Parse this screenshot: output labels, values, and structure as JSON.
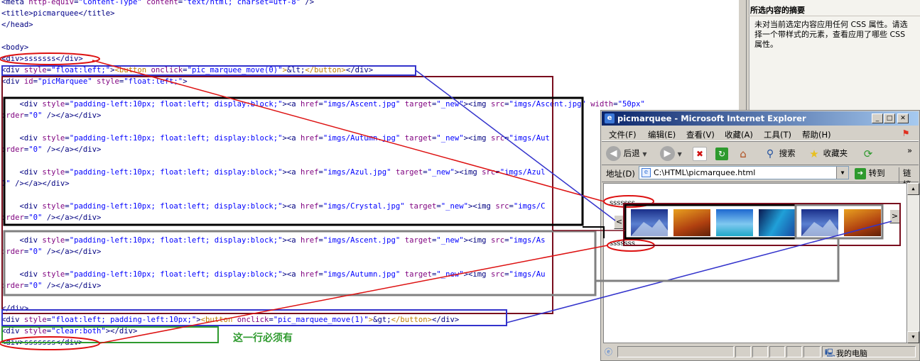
{
  "code_lines": [
    [
      [
        "t",
        "<meta "
      ],
      [
        "a",
        "http-equiv"
      ],
      [
        "t",
        "="
      ],
      [
        "v",
        "\"Content-Type\""
      ],
      [
        "t",
        " "
      ],
      [
        "a",
        "content"
      ],
      [
        "t",
        "="
      ],
      [
        "v",
        "\"text/html; charset=utf-8\""
      ],
      [
        "t",
        " />"
      ]
    ],
    [
      [
        "t",
        "<title>"
      ],
      [
        "s",
        "picmarquee"
      ],
      [
        "t",
        "</title>"
      ]
    ],
    [
      [
        "t",
        "</head>"
      ]
    ],
    [
      [
        "s",
        ""
      ]
    ],
    [
      [
        "t",
        "<body>"
      ]
    ],
    [
      [
        "t",
        "<div>"
      ],
      [
        "s",
        "sssssss"
      ],
      [
        "t",
        "</div>"
      ]
    ],
    [
      [
        "t",
        "<div "
      ],
      [
        "a",
        "style"
      ],
      [
        "t",
        "="
      ],
      [
        "v",
        "\"float:left;\""
      ],
      [
        "t",
        ">"
      ],
      [
        "o",
        "<button "
      ],
      [
        "a",
        "onclick"
      ],
      [
        "t",
        "="
      ],
      [
        "v",
        "\"pic_marquee_move(0)\""
      ],
      [
        "o",
        ">"
      ],
      [
        "s",
        "&lt;"
      ],
      [
        "o",
        "</button>"
      ],
      [
        "t",
        "</div>"
      ]
    ],
    [
      [
        "t",
        "<div "
      ],
      [
        "a",
        "id"
      ],
      [
        "t",
        "="
      ],
      [
        "v",
        "\"picMarquee\""
      ],
      [
        "t",
        " "
      ],
      [
        "a",
        "style"
      ],
      [
        "t",
        "="
      ],
      [
        "v",
        "\"float:left;\""
      ],
      [
        "t",
        ">"
      ]
    ],
    [
      [
        "s",
        ""
      ]
    ],
    [
      [
        "s",
        "    "
      ],
      [
        "t",
        "<div "
      ],
      [
        "a",
        "style"
      ],
      [
        "t",
        "="
      ],
      [
        "v",
        "\"padding-left:10px; float:left; display:block;\""
      ],
      [
        "t",
        "><a "
      ],
      [
        "a",
        "href"
      ],
      [
        "t",
        "="
      ],
      [
        "v",
        "\"imgs/Ascent.jpg\""
      ],
      [
        "t",
        " "
      ],
      [
        "a",
        "target"
      ],
      [
        "t",
        "="
      ],
      [
        "v",
        "\"_new\""
      ],
      [
        "t",
        "><img "
      ],
      [
        "a",
        "src"
      ],
      [
        "t",
        "="
      ],
      [
        "v",
        "\"imgs/Ascent.jpg\""
      ],
      [
        "t",
        " "
      ],
      [
        "a",
        "width"
      ],
      [
        "t",
        "="
      ],
      [
        "v",
        "\"50px\""
      ]
    ],
    [
      [
        "a",
        "order"
      ],
      [
        "t",
        "="
      ],
      [
        "v",
        "\"0\""
      ],
      [
        "t",
        " /></a></div>"
      ]
    ],
    [
      [
        "s",
        ""
      ]
    ],
    [
      [
        "s",
        "    "
      ],
      [
        "t",
        "<div "
      ],
      [
        "a",
        "style"
      ],
      [
        "t",
        "="
      ],
      [
        "v",
        "\"padding-left:10px; float:left; display:block;\""
      ],
      [
        "t",
        "><a "
      ],
      [
        "a",
        "href"
      ],
      [
        "t",
        "="
      ],
      [
        "v",
        "\"imgs/Autumn.jpg\""
      ],
      [
        "t",
        " "
      ],
      [
        "a",
        "target"
      ],
      [
        "t",
        "="
      ],
      [
        "v",
        "\"_new\""
      ],
      [
        "t",
        "><img "
      ],
      [
        "a",
        "src"
      ],
      [
        "t",
        "="
      ],
      [
        "v",
        "\"imgs/Aut"
      ]
    ],
    [
      [
        "a",
        "order"
      ],
      [
        "t",
        "="
      ],
      [
        "v",
        "\"0\""
      ],
      [
        "t",
        " /></a></div>"
      ]
    ],
    [
      [
        "s",
        ""
      ]
    ],
    [
      [
        "s",
        "    "
      ],
      [
        "t",
        "<div "
      ],
      [
        "a",
        "style"
      ],
      [
        "t",
        "="
      ],
      [
        "v",
        "\"padding-left:10px; float:left; display:block;\""
      ],
      [
        "t",
        "><a "
      ],
      [
        "a",
        "href"
      ],
      [
        "t",
        "="
      ],
      [
        "v",
        "\"imgs/Azul.jpg\""
      ],
      [
        "t",
        " "
      ],
      [
        "a",
        "target"
      ],
      [
        "t",
        "="
      ],
      [
        "v",
        "\"_new\""
      ],
      [
        "t",
        "><img "
      ],
      [
        "a",
        "src"
      ],
      [
        "t",
        "="
      ],
      [
        "v",
        "\"imgs/Azul"
      ]
    ],
    [
      [
        "v",
        "0\""
      ],
      [
        "t",
        " /></a></div>"
      ]
    ],
    [
      [
        "s",
        ""
      ]
    ],
    [
      [
        "s",
        "    "
      ],
      [
        "t",
        "<div "
      ],
      [
        "a",
        "style"
      ],
      [
        "t",
        "="
      ],
      [
        "v",
        "\"padding-left:10px; float:left; display:block;\""
      ],
      [
        "t",
        "><a "
      ],
      [
        "a",
        "href"
      ],
      [
        "t",
        "="
      ],
      [
        "v",
        "\"imgs/Crystal.jpg\""
      ],
      [
        "t",
        " "
      ],
      [
        "a",
        "target"
      ],
      [
        "t",
        "="
      ],
      [
        "v",
        "\"_new\""
      ],
      [
        "t",
        "><img "
      ],
      [
        "a",
        "src"
      ],
      [
        "t",
        "="
      ],
      [
        "v",
        "\"imgs/C"
      ]
    ],
    [
      [
        "a",
        "order"
      ],
      [
        "t",
        "="
      ],
      [
        "v",
        "\"0\""
      ],
      [
        "t",
        " /></a></div>"
      ]
    ],
    [
      [
        "s",
        ""
      ]
    ],
    [
      [
        "s",
        "    "
      ],
      [
        "t",
        "<div "
      ],
      [
        "a",
        "style"
      ],
      [
        "t",
        "="
      ],
      [
        "v",
        "\"padding-left:10px; float:left; display:block;\""
      ],
      [
        "t",
        "><a "
      ],
      [
        "a",
        "href"
      ],
      [
        "t",
        "="
      ],
      [
        "v",
        "\"imgs/Ascent.jpg\""
      ],
      [
        "t",
        " "
      ],
      [
        "a",
        "target"
      ],
      [
        "t",
        "="
      ],
      [
        "v",
        "\"_new\""
      ],
      [
        "t",
        "><img "
      ],
      [
        "a",
        "src"
      ],
      [
        "t",
        "="
      ],
      [
        "v",
        "\"imgs/As"
      ]
    ],
    [
      [
        "a",
        "order"
      ],
      [
        "t",
        "="
      ],
      [
        "v",
        "\"0\""
      ],
      [
        "t",
        " /></a></div>"
      ]
    ],
    [
      [
        "s",
        ""
      ]
    ],
    [
      [
        "s",
        "    "
      ],
      [
        "t",
        "<div "
      ],
      [
        "a",
        "style"
      ],
      [
        "t",
        "="
      ],
      [
        "v",
        "\"padding-left:10px; float:left; display:block;\""
      ],
      [
        "t",
        "><a "
      ],
      [
        "a",
        "href"
      ],
      [
        "t",
        "="
      ],
      [
        "v",
        "\"imgs/Autumn.jpg\""
      ],
      [
        "t",
        " "
      ],
      [
        "a",
        "target"
      ],
      [
        "t",
        "="
      ],
      [
        "v",
        "\"_new\""
      ],
      [
        "t",
        "><img "
      ],
      [
        "a",
        "src"
      ],
      [
        "t",
        "="
      ],
      [
        "v",
        "\"imgs/Au"
      ]
    ],
    [
      [
        "a",
        "order"
      ],
      [
        "t",
        "="
      ],
      [
        "v",
        "\"0\""
      ],
      [
        "t",
        " /></a></div>"
      ]
    ],
    [
      [
        "s",
        ""
      ]
    ],
    [
      [
        "t",
        "</div>"
      ]
    ],
    [
      [
        "t",
        "<div "
      ],
      [
        "a",
        "style"
      ],
      [
        "t",
        "="
      ],
      [
        "v",
        "\"float:left; padding-left:10px;\""
      ],
      [
        "t",
        ">"
      ],
      [
        "o",
        "<button "
      ],
      [
        "a",
        "onclick"
      ],
      [
        "t",
        "="
      ],
      [
        "v",
        "\"pic_marquee_move(1)\""
      ],
      [
        "o",
        ">"
      ],
      [
        "s",
        "&gt;"
      ],
      [
        "o",
        "</button>"
      ],
      [
        "t",
        "</div>"
      ]
    ],
    [
      [
        "t",
        "<div "
      ],
      [
        "a",
        "style"
      ],
      [
        "t",
        "="
      ],
      [
        "v",
        "\"clear:both\""
      ],
      [
        "t",
        "></div>"
      ]
    ],
    [
      [
        "t",
        "<div>"
      ],
      [
        "s",
        "sssssss"
      ],
      [
        "t",
        "</div>"
      ]
    ]
  ],
  "annotation_note": "这一行必须有",
  "summary_panel": {
    "heading": "所选内容的摘要",
    "body": "未对当前选定内容应用任何 CSS 属性。请选择一个带样式的元素，查看应用了哪些 CSS 属性。"
  },
  "browser": {
    "title": "picmarquee - Microsoft Internet Explorer",
    "app_icon": "e",
    "window_buttons": {
      "minimize": "_",
      "maximize": "□",
      "close": "✕"
    },
    "menu": [
      "文件(F)",
      "编辑(E)",
      "查看(V)",
      "收藏(A)",
      "工具(T)",
      "帮助(H)"
    ],
    "toolbar": {
      "back": "后退",
      "search": "搜索",
      "favorites": "收藏夹",
      "more": "»"
    },
    "address_label": "地址(D)",
    "address_value": "C:\\HTML\\picmarquee.html",
    "go_label": "转到",
    "links_label": "链接",
    "status_zone": "我的电脑",
    "page": {
      "top_text": "sssssss",
      "bottom_text": "sssssss",
      "prev_button": "<",
      "next_button": ">",
      "thumbnails": [
        "Ascent",
        "Autumn",
        "Azul",
        "Crystal",
        "Ascent",
        "Autumn"
      ]
    }
  },
  "colors": {
    "red": "#dd1111",
    "blue": "#3333cc",
    "maroon": "#7a0e1e",
    "black": "#000000",
    "gray": "#808080",
    "green": "#2e9a2e",
    "tag": "#000080",
    "attribute": "#7f007f",
    "value": "#0000ff",
    "button_tag": "#c08000"
  }
}
